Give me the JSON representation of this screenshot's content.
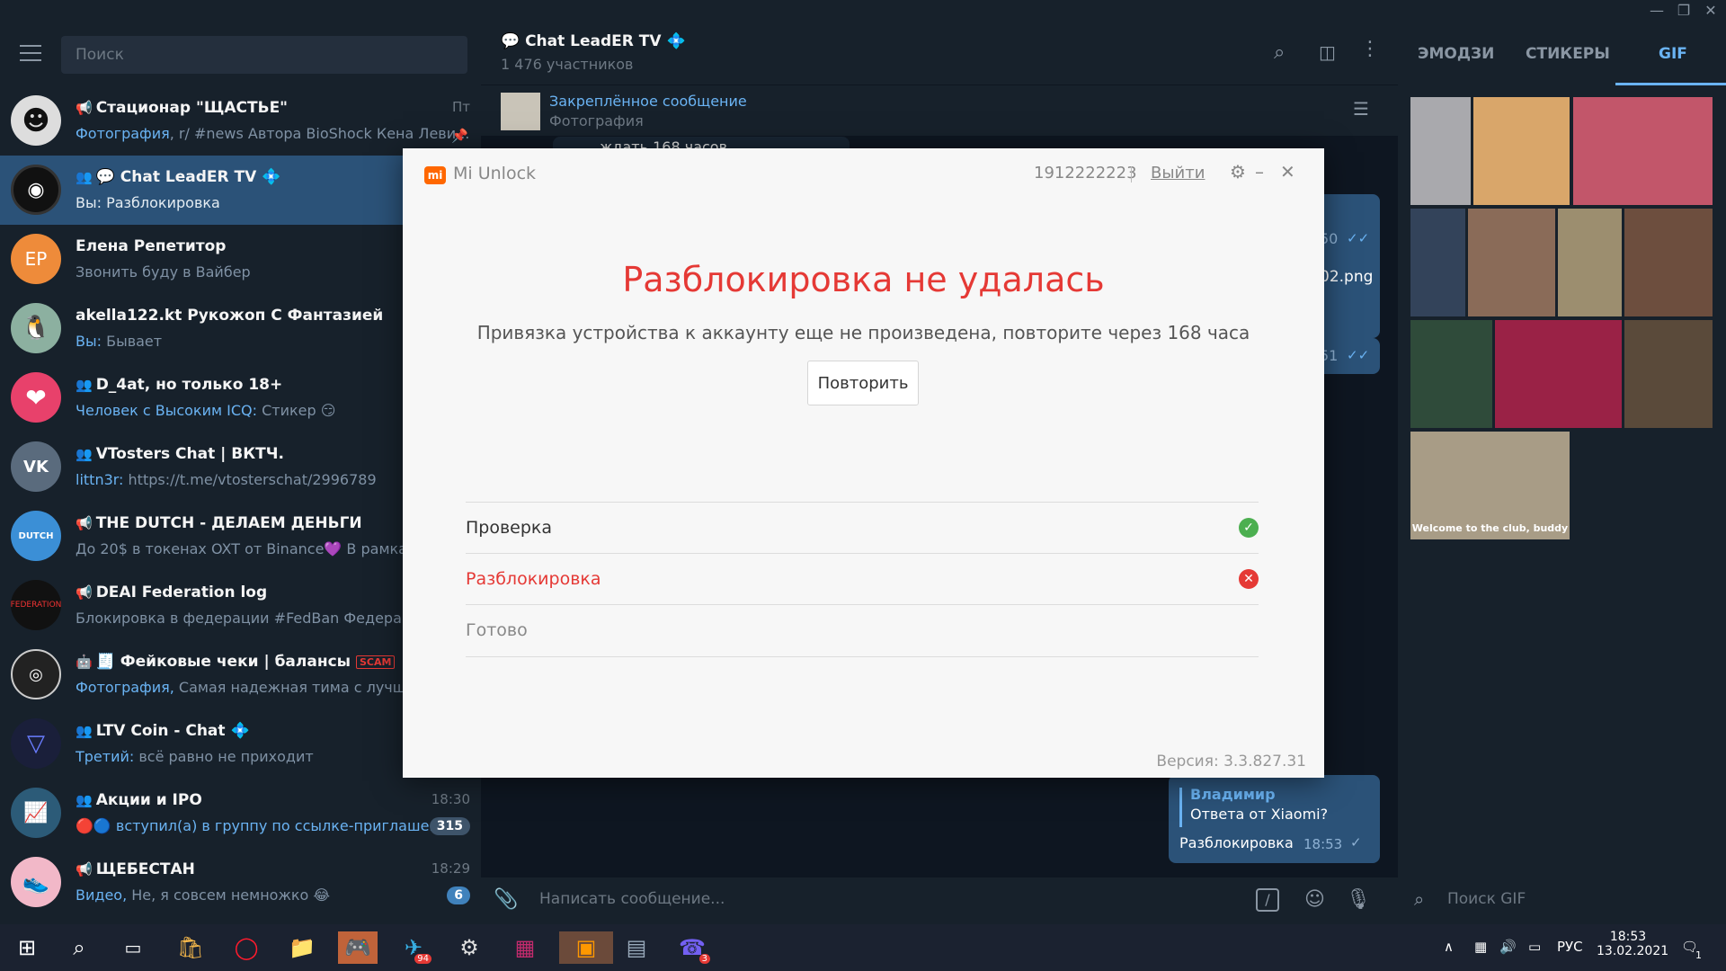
{
  "window": {
    "minimize": "—",
    "restore": "❐",
    "close": "✕"
  },
  "left": {
    "search_placeholder": "Поиск",
    "chats": [
      {
        "title": "Стационар \"ЩАСТЬЕ\"",
        "prefix": "Фотография",
        "sub": ", r/ #news Автора BioShock Кена Леви...",
        "time": "Пт"
      },
      {
        "title": "💬 Chat LeadER TV",
        "sub": "Вы: Разблокировка"
      },
      {
        "title": "Елена Репетитор",
        "sub": "Звонить буду в Вайбер",
        "initials": "ЕР"
      },
      {
        "title": "akella122.kt Рукожоп С Фантазией",
        "prefix": "Вы:",
        "sub": " Бывает"
      },
      {
        "title": "D_4at, но только 18+",
        "prefix": "Человек с Высоким ICQ:",
        "sub": " Стикер 😏"
      },
      {
        "title": "VTosters Chat | ВКТЧ.",
        "prefix": "littn3r:",
        "sub": " https://t.me/vtosterschat/2996789"
      },
      {
        "title": "THE DUTCH - ДЕЛАЕМ ДЕНЬГИ",
        "sub": "До 20$ в токенах OXT от Binance💜 В рамках В"
      },
      {
        "title": "DEAI Federation log",
        "sub": "Блокировка в федерации #FedBan Федерация:"
      },
      {
        "title": "🧾 Фейковые чеки | балансы",
        "scam": "SCAM",
        "prefix": "Фотография,",
        "sub": " Самая надежная тима с лучшими"
      },
      {
        "title": "LTV Coin - Chat",
        "prefix": "Третий:",
        "sub": " всё равно не приходит"
      },
      {
        "title": "Акции и IPO",
        "prefix": "🔴🔵 вступил(а) в группу по ссылке-приглашен...",
        "sub": "",
        "time": "18:30",
        "badge": "315"
      },
      {
        "title": "ЩЕБЕСТАН",
        "prefix": "Видео,",
        "sub": " Не, я совсем  немножко 😂",
        "time": "18:29",
        "badge": "6"
      }
    ]
  },
  "mid": {
    "title": "💬 Chat LeadER TV 💠",
    "members": "1 476 участников",
    "pinned_title": "Закреплённое сообщение",
    "pinned_sub": "Фотография",
    "partial_msg": "ждать 168 часов",
    "time1": "50",
    "file": "02.png",
    "time2": "51",
    "reply_author": "Владимир",
    "reply_text": "Ответа от Xiaomi?",
    "msg": "Разблокировка",
    "msg_time": "18:53",
    "composer_placeholder": "Написать сообщение..."
  },
  "right": {
    "tabs": [
      "ЭМОДЗИ",
      "СТИКЕРЫ",
      "GIF"
    ],
    "gif_caption": "Welcome to the club, buddy",
    "search_placeholder": "Поиск GIF"
  },
  "taskbar": {
    "telegram_badge": "94",
    "viber_badge": "3",
    "lang": "РУС",
    "time": "18:53",
    "date": "13.02.2021",
    "notif": "1"
  },
  "modal": {
    "app_name": "Mi Unlock",
    "account": "1912222223",
    "exit": "Выйти",
    "heading": "Разблокировка не удалась",
    "message": "Привязка устройства к аккаунту еще не произведена, повторите через 168 часа",
    "retry": "Повторить",
    "steps": [
      "Проверка",
      "Разблокировка",
      "Готово"
    ],
    "version": "Версия: 3.3.827.31",
    "colors": {
      "error": "#e53935",
      "success": "#4caf50",
      "brand": "#ff6700"
    }
  }
}
